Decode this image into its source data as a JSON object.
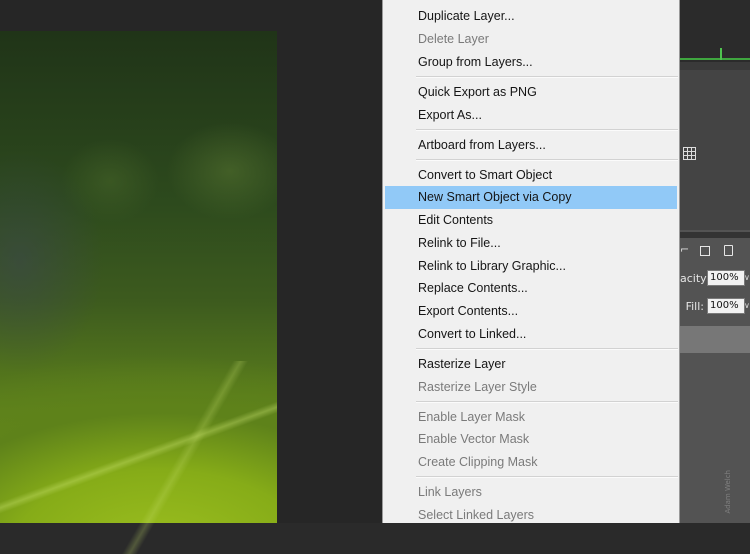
{
  "layers_panel": {
    "opacity_label": "acity:",
    "opacity_value": "100%",
    "fill_label": "Fill:",
    "fill_value": "100%",
    "dropdown_glyph": "∨"
  },
  "watermark_text": "Adam Welch",
  "context_menu": {
    "items": [
      {
        "label": "Duplicate Layer...",
        "enabled": true
      },
      {
        "label": "Delete Layer",
        "enabled": false
      },
      {
        "label": "Group from Layers...",
        "enabled": true
      },
      {
        "label": "Quick Export as PNG",
        "enabled": true
      },
      {
        "label": "Export As...",
        "enabled": true
      },
      {
        "label": "Artboard from Layers...",
        "enabled": true
      },
      {
        "label": "Convert to Smart Object",
        "enabled": true
      },
      {
        "label": "New Smart Object via Copy",
        "enabled": true,
        "highlighted": true
      },
      {
        "label": "Edit Contents",
        "enabled": true
      },
      {
        "label": "Relink to File...",
        "enabled": true
      },
      {
        "label": "Relink to Library Graphic...",
        "enabled": true
      },
      {
        "label": "Replace Contents...",
        "enabled": true
      },
      {
        "label": "Export Contents...",
        "enabled": true
      },
      {
        "label": "Convert to Linked...",
        "enabled": true
      },
      {
        "label": "Rasterize Layer",
        "enabled": true
      },
      {
        "label": "Rasterize Layer Style",
        "enabled": false
      },
      {
        "label": "Enable Layer Mask",
        "enabled": false
      },
      {
        "label": "Enable Vector Mask",
        "enabled": false
      },
      {
        "label": "Create Clipping Mask",
        "enabled": false
      },
      {
        "label": "Link Layers",
        "enabled": false
      },
      {
        "label": "Select Linked Layers",
        "enabled": false
      }
    ]
  },
  "colors": {
    "menu_background": "#f0f0f0",
    "menu_highlight": "#91c9f7",
    "menu_text": "#151515",
    "menu_text_disabled": "#7a7a7a",
    "panel_background": "#535353"
  }
}
